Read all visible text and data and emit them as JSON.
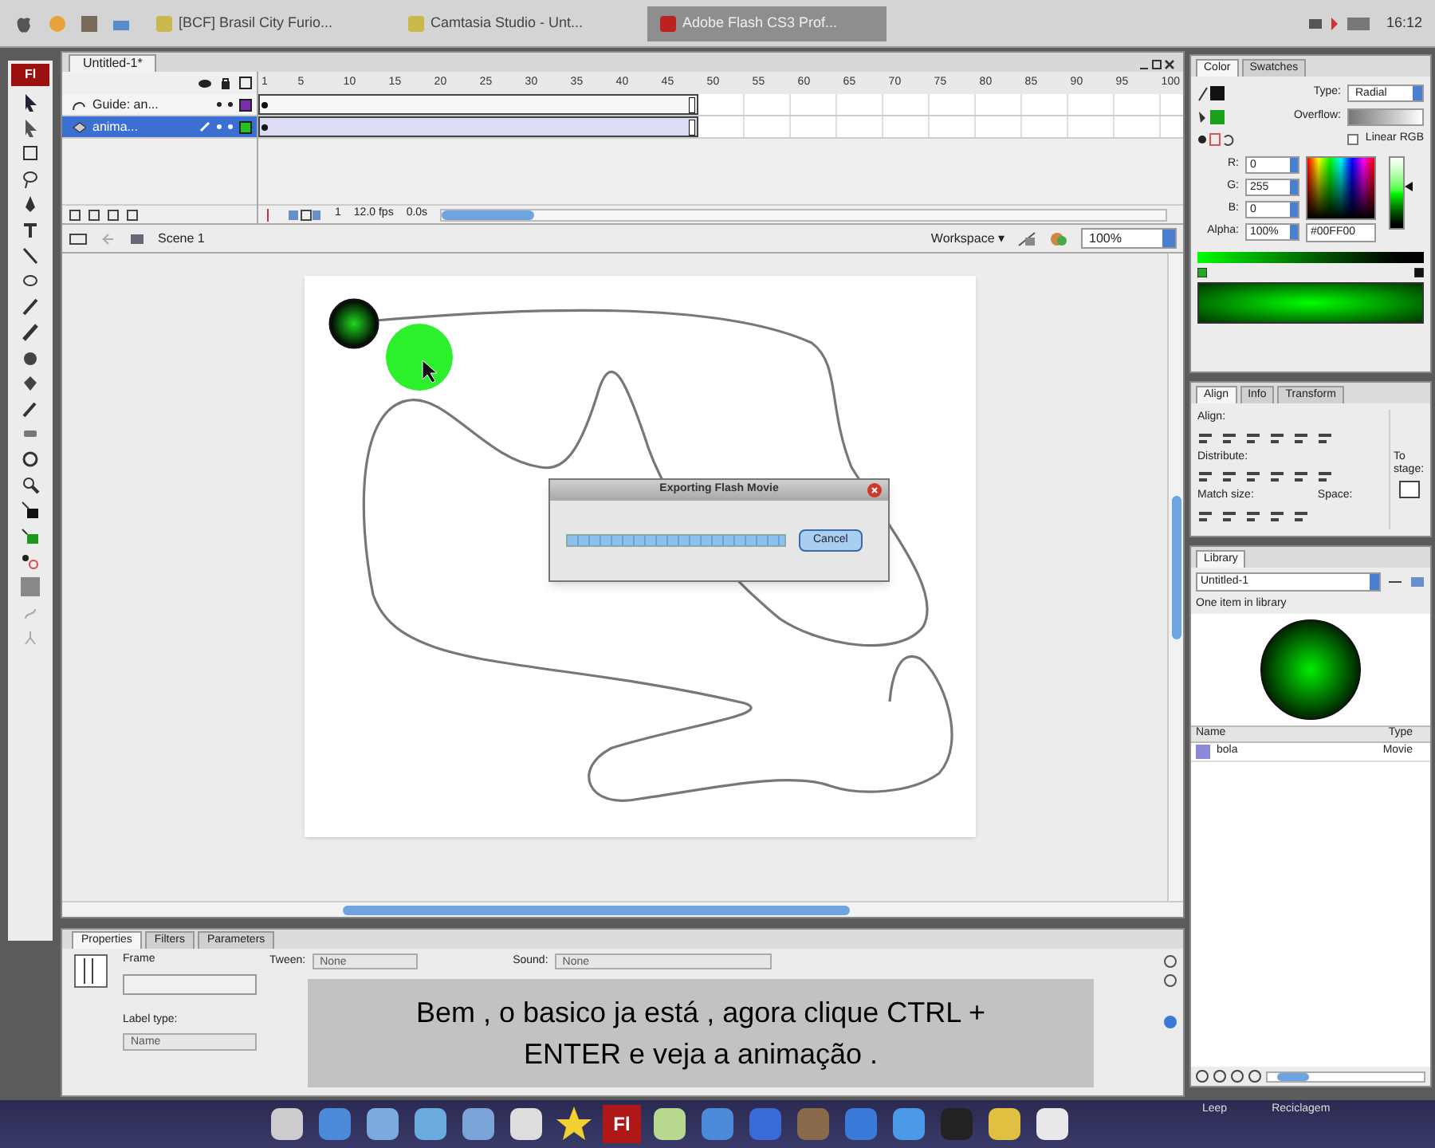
{
  "taskbar": {
    "tabs": [
      {
        "label": "[BCF] Brasil City Furio...",
        "selected": false
      },
      {
        "label": "Camtasia Studio - Unt...",
        "selected": false
      },
      {
        "label": "Adobe Flash CS3 Prof...",
        "selected": true
      }
    ],
    "clock": "16:12"
  },
  "document": {
    "tab": "Untitled-1*"
  },
  "timeline": {
    "frame_numbers": [
      "1",
      "5",
      "10",
      "15",
      "20",
      "25",
      "30",
      "35",
      "40",
      "45",
      "50",
      "55",
      "60",
      "65",
      "70",
      "75",
      "80",
      "85",
      "90",
      "95",
      "100"
    ],
    "layers": [
      {
        "name": "Guide: an...",
        "kind": "guide",
        "selected": false,
        "color": "#7a2fb0"
      },
      {
        "name": "anima...",
        "kind": "normal",
        "selected": true,
        "color": "#22c322"
      }
    ],
    "current_frame": "1",
    "fps": "12.0 fps",
    "elapsed": "0.0s"
  },
  "edit_bar": {
    "scene": "Scene 1",
    "workspace": "Workspace ▾",
    "zoom": "100%"
  },
  "dialog": {
    "title": "Exporting Flash Movie",
    "level": 1,
    "button": "Cancel"
  },
  "properties": {
    "tabs": [
      {
        "label": "Properties",
        "selected": true
      },
      {
        "label": "Filters",
        "selected": false
      },
      {
        "label": "Parameters",
        "selected": false
      }
    ],
    "frame_label": "Frame",
    "tween_label": "Tween:",
    "tween": "None",
    "sound_label": "Sound:",
    "sound": "None",
    "label_type_label": "Label type:",
    "label_type": "Name"
  },
  "caption": [
    "Bem , o basico ja está , agora clique CTRL +",
    "ENTER e veja a animação ."
  ],
  "color_panel": {
    "tabs": [
      {
        "label": "Color",
        "selected": true
      },
      {
        "label": "Swatches",
        "selected": false
      }
    ],
    "type_label": "Type:",
    "type": "Radial",
    "overflow_label": "Overflow:",
    "linear_rgb": {
      "label": "Linear RGB",
      "checked": false
    },
    "fields": [
      {
        "label": "R:",
        "value": "0"
      },
      {
        "label": "G:",
        "value": "255"
      },
      {
        "label": "B:",
        "value": "0"
      },
      {
        "label": "Alpha:",
        "value": "100%"
      }
    ],
    "hex": "#00FF00",
    "brightness": {
      "level": 0.6
    }
  },
  "align_panel": {
    "tabs": [
      {
        "label": "Align",
        "selected": true
      },
      {
        "label": "Info",
        "selected": false
      },
      {
        "label": "Transform",
        "selected": false
      }
    ],
    "align_label": "Align:",
    "distribute_label": "Distribute:",
    "match_label": "Match size:",
    "space_label": "Space:",
    "stage_label": "To stage:"
  },
  "library": {
    "tab": "Library",
    "document": "Untitled-1",
    "count": "One item in library",
    "columns": [
      "Name",
      "Type"
    ],
    "items": [
      {
        "name": "bola",
        "type": "Movie",
        "selected": false
      }
    ]
  },
  "desktop": {
    "labels": [
      "Leep",
      "Reciclagem"
    ]
  },
  "toolbar": {
    "logo": "Fl"
  },
  "dock": {
    "app_label": "Fl"
  }
}
